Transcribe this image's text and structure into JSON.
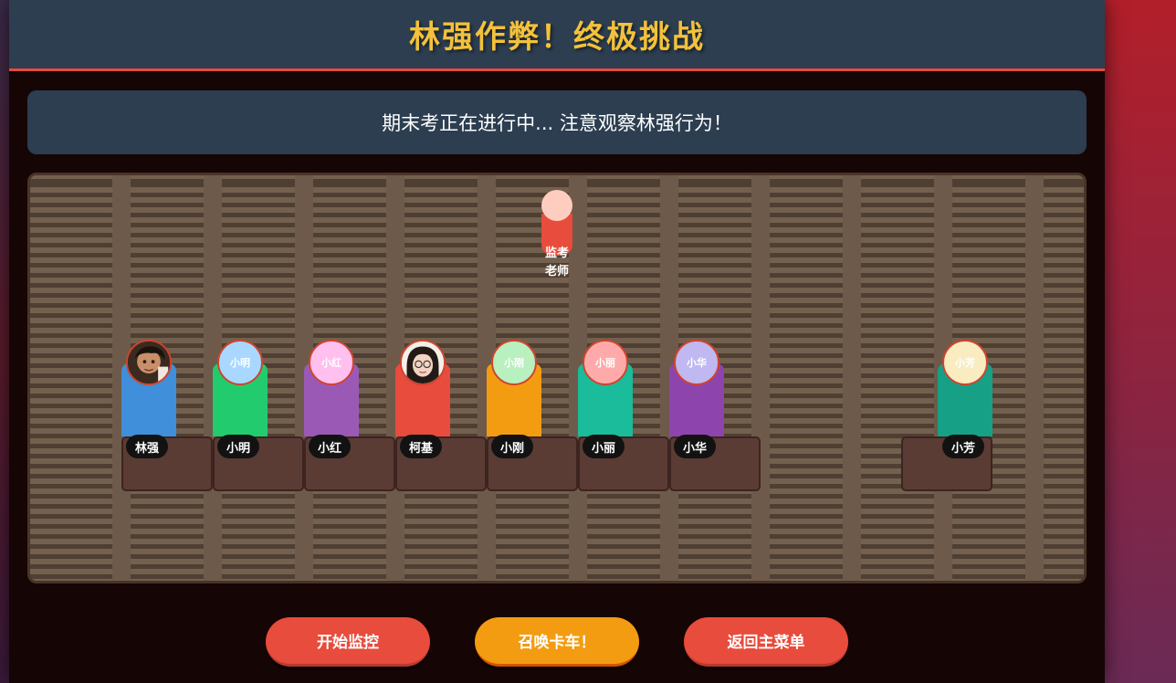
{
  "header": {
    "title": "林强作弊！终极挑战"
  },
  "status": {
    "message": "期末考正在进行中... 注意观察林强行为！"
  },
  "teacher": {
    "label_line1": "监考",
    "label_line2": "老师",
    "head_color": "#ffcdc0",
    "body_color": "#e74c3c"
  },
  "students": [
    {
      "name": "林强",
      "avatar_text": "",
      "avatar_type": "photo-boy",
      "body_color": "#3f8fda",
      "avatar_bg": "#3a2a20"
    },
    {
      "name": "小明",
      "avatar_text": "小明",
      "avatar_type": "initial",
      "body_color": "#22cc6e",
      "avatar_bg": "#a8d8ff"
    },
    {
      "name": "小红",
      "avatar_text": "小红",
      "avatar_type": "initial",
      "body_color": "#9b59b6",
      "avatar_bg": "#ffc0f0"
    },
    {
      "name": "柯基",
      "avatar_text": "",
      "avatar_type": "photo-girl",
      "body_color": "#e74c3c",
      "avatar_bg": "#f4efe8"
    },
    {
      "name": "小刚",
      "avatar_text": "小刚",
      "avatar_type": "initial",
      "body_color": "#f39c12",
      "avatar_bg": "#b8f0c0"
    },
    {
      "name": "小丽",
      "avatar_text": "小丽",
      "avatar_type": "initial",
      "body_color": "#1abc9c",
      "avatar_bg": "#ffaaaa"
    },
    {
      "name": "小华",
      "avatar_text": "小华",
      "avatar_type": "initial",
      "body_color": "#8e44ad",
      "avatar_bg": "#c0b8f0"
    },
    {
      "name": "小芳",
      "avatar_text": "小芳",
      "avatar_type": "initial",
      "body_color": "#16a085",
      "avatar_bg": "#f8ecc0"
    }
  ],
  "buttons": {
    "start_label": "开始监控",
    "truck_label": "召唤卡车！",
    "menu_label": "返回主菜单"
  },
  "colors": {
    "accent": "#e74c3c",
    "title": "#f4c13a",
    "panel": "#2c3e50",
    "desk": "#5a3c34"
  }
}
